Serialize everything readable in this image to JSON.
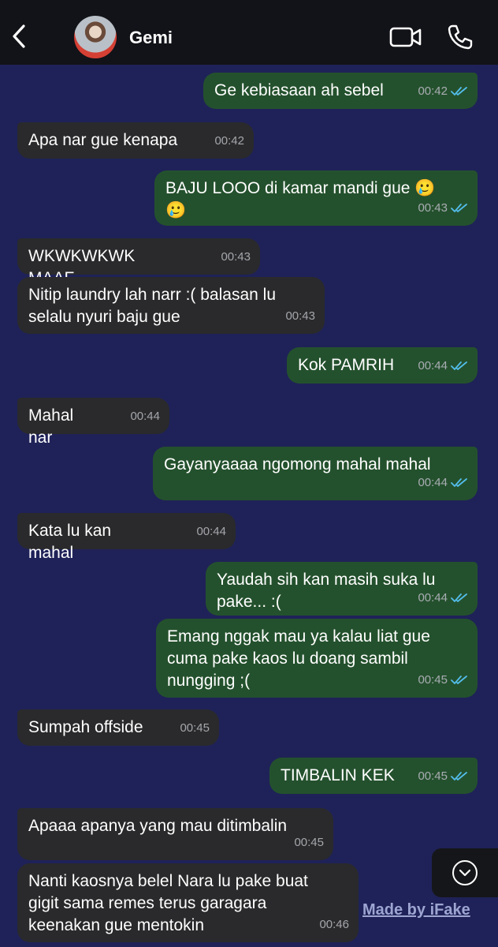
{
  "header": {
    "contact_name": "Gemi"
  },
  "colors": {
    "chat_background": "#1f2258",
    "header_background": "#121318",
    "incoming_bubble": "#2a2a2c",
    "outgoing_bubble": "#24512d",
    "read_ticks": "#53bdeb"
  },
  "messages": [
    {
      "dir": "out",
      "text": "Ge kebiasaan ah sebel",
      "time": "00:42",
      "read": true
    },
    {
      "dir": "in",
      "text": "Apa nar gue kenapa",
      "time": "00:42"
    },
    {
      "dir": "out",
      "text": "BAJU LOOO di kamar mandi gue 🥲\n🥲",
      "time": "00:43",
      "read": true
    },
    {
      "dir": "in",
      "text": "WKWKWKWK MAAF",
      "time": "00:43"
    },
    {
      "dir": "in",
      "text": "Nitip laundry lah narr :( balasan lu\nselalu nyuri baju gue",
      "time": "00:43"
    },
    {
      "dir": "out",
      "text": "Kok PAMRIH",
      "time": "00:44",
      "read": true
    },
    {
      "dir": "in",
      "text": "Mahal nar",
      "time": "00:44"
    },
    {
      "dir": "out",
      "text": "Gayanyaaaa ngomong mahal mahal",
      "time": "00:44",
      "read": true
    },
    {
      "dir": "in",
      "text": "Kata lu kan mahal",
      "time": "00:44"
    },
    {
      "dir": "out",
      "text": "Yaudah sih kan masih suka lu\npake... :(",
      "time": "00:44",
      "read": true
    },
    {
      "dir": "out",
      "text": "Emang nggak mau ya kalau liat gue\ncuma pake kaos lu doang sambil\nnungging ;(",
      "time": "00:45",
      "read": true
    },
    {
      "dir": "in",
      "text": "Sumpah offside",
      "time": "00:45"
    },
    {
      "dir": "out",
      "text": "TIMBALIN KEK",
      "time": "00:45",
      "read": true
    },
    {
      "dir": "in",
      "text": "Apaaa apanya yang mau ditimbalin",
      "time": "00:45"
    },
    {
      "dir": "in",
      "text": "Nanti kaosnya belel Nara lu pake buat\ngigit sama remes terus garagara\nkeenakan gue mentokin",
      "time": "00:46"
    }
  ],
  "icons": {
    "back": "chevron-left-icon",
    "video": "video-camera-icon",
    "call": "phone-icon",
    "scroll": "chevron-down-icon"
  },
  "watermark": "Made by iFake"
}
